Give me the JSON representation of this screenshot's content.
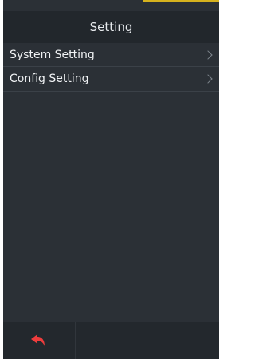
{
  "header": {
    "title": "Setting"
  },
  "menu": {
    "items": [
      {
        "label": "System Setting",
        "icon": "chevron-right-icon"
      },
      {
        "label": "Config Setting",
        "icon": "chevron-right-icon"
      }
    ]
  },
  "footer": {
    "back_icon": "back-arrow-icon"
  },
  "colors": {
    "background": "#2b3036",
    "title_bar": "#22272c",
    "accent": "#d6b21e",
    "back_arrow": "#ef3d3d"
  }
}
